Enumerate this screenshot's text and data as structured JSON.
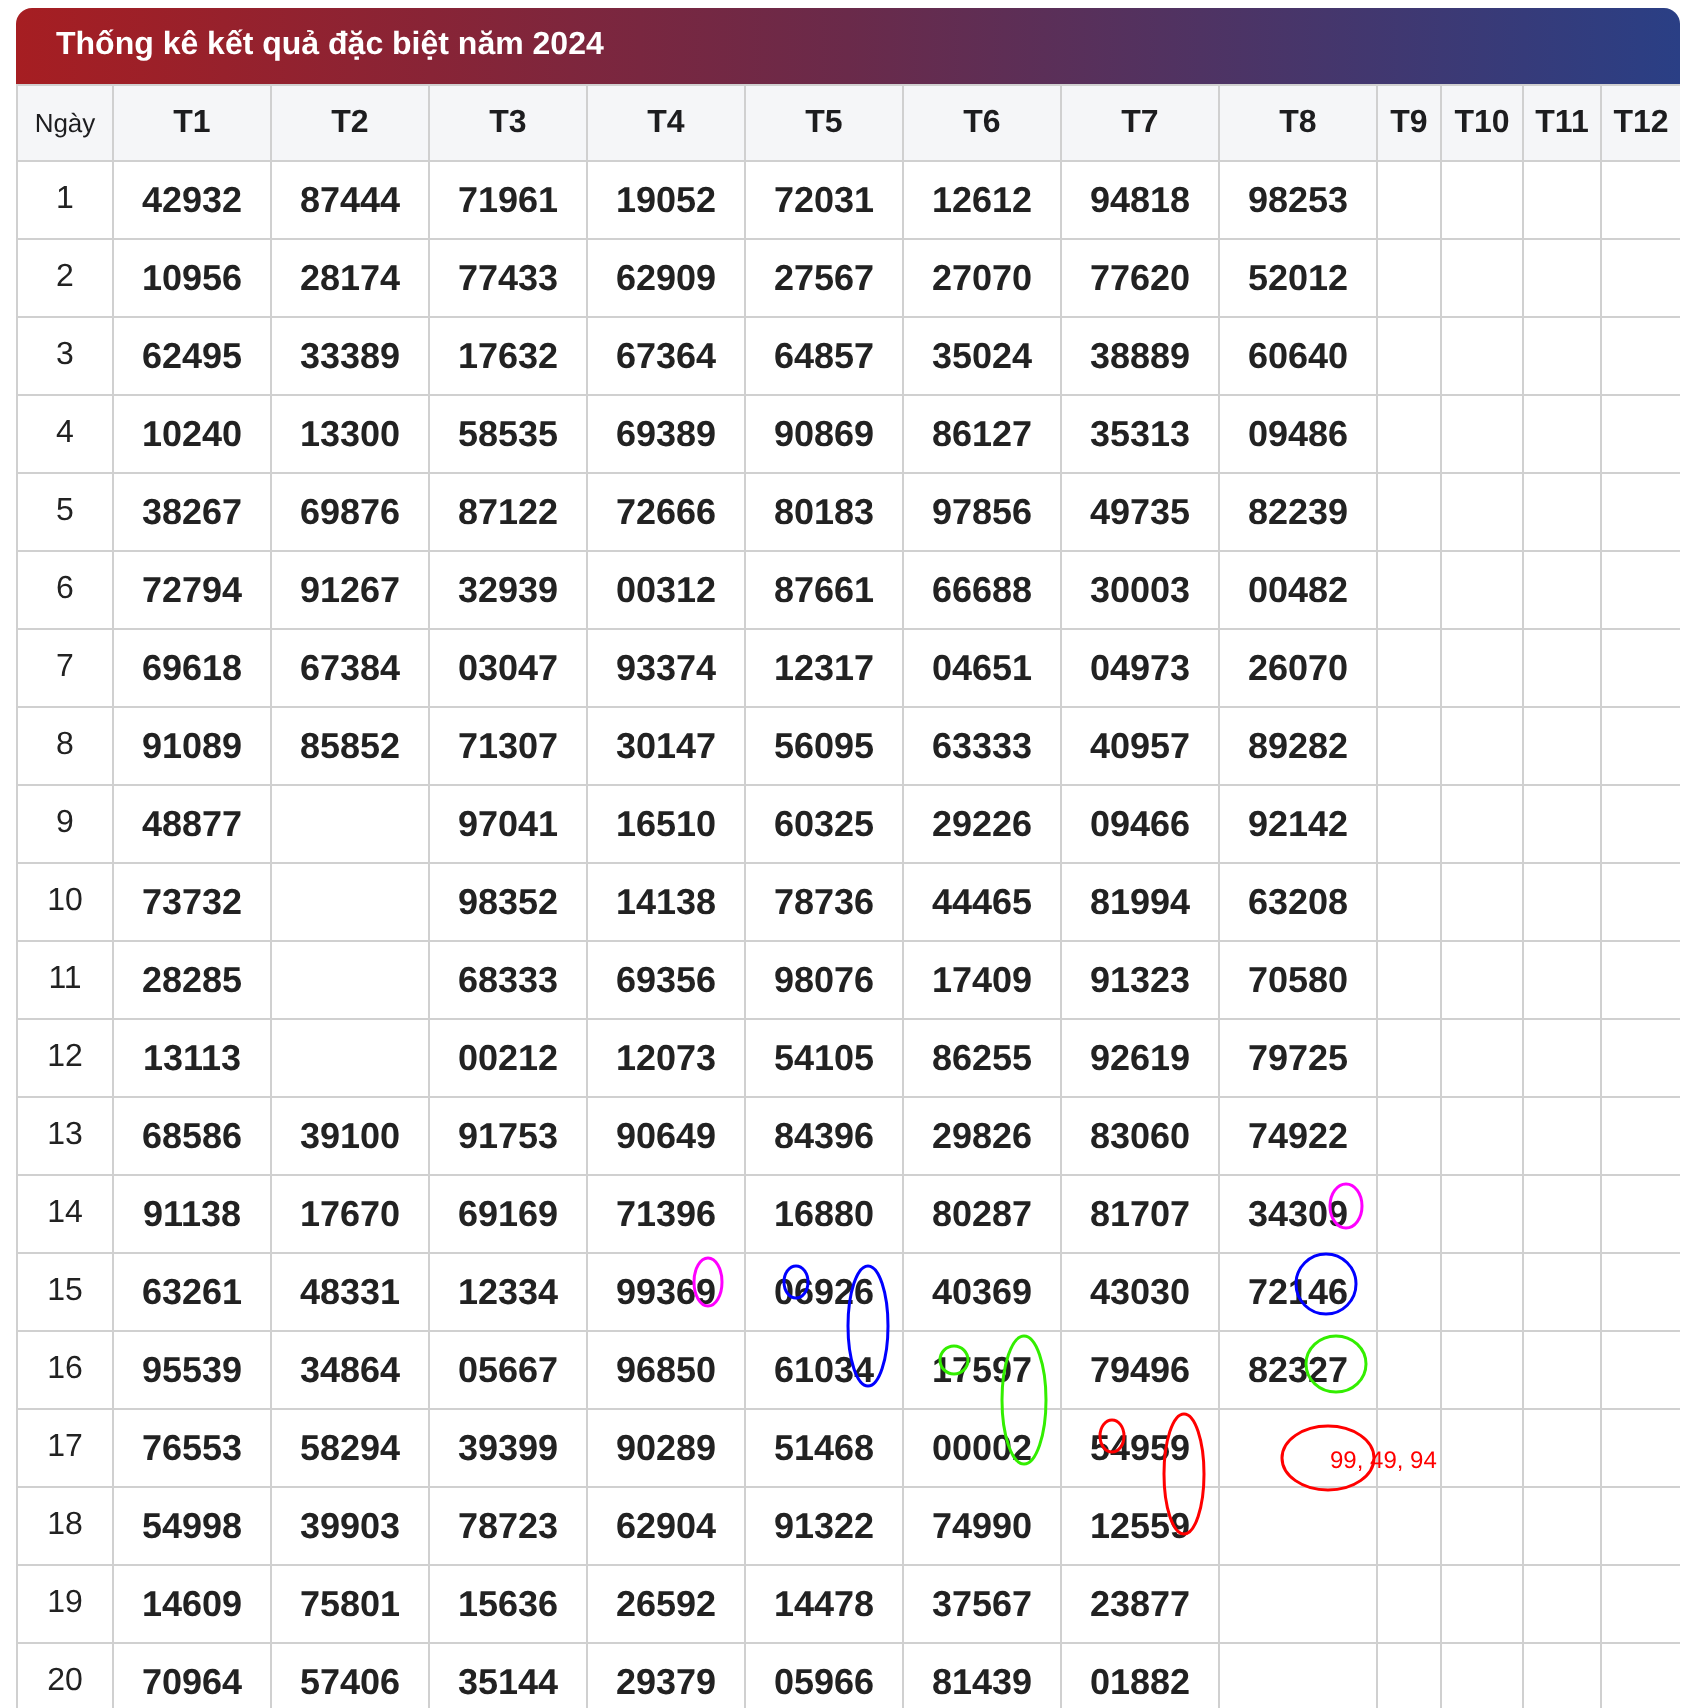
{
  "title": "Thống kê kết quả đặc biệt năm 2024",
  "columns": [
    "Ngày",
    "T1",
    "T2",
    "T3",
    "T4",
    "T5",
    "T6",
    "T7",
    "T8",
    "T9",
    "T10",
    "T11",
    "T12"
  ],
  "rows": [
    {
      "day": "1",
      "values": [
        "42932",
        "87444",
        "71961",
        "19052",
        "72031",
        "12612",
        "94818",
        "98253"
      ]
    },
    {
      "day": "2",
      "values": [
        "10956",
        "28174",
        "77433",
        "62909",
        "27567",
        "27070",
        "77620",
        "52012"
      ]
    },
    {
      "day": "3",
      "values": [
        "62495",
        "33389",
        "17632",
        "67364",
        "64857",
        "35024",
        "38889",
        "60640"
      ]
    },
    {
      "day": "4",
      "values": [
        "10240",
        "13300",
        "58535",
        "69389",
        "90869",
        "86127",
        "35313",
        "09486"
      ]
    },
    {
      "day": "5",
      "values": [
        "38267",
        "69876",
        "87122",
        "72666",
        "80183",
        "97856",
        "49735",
        "82239"
      ]
    },
    {
      "day": "6",
      "values": [
        "72794",
        "91267",
        "32939",
        "00312",
        "87661",
        "66688",
        "30003",
        "00482"
      ]
    },
    {
      "day": "7",
      "values": [
        "69618",
        "67384",
        "03047",
        "93374",
        "12317",
        "04651",
        "04973",
        "26070"
      ]
    },
    {
      "day": "8",
      "values": [
        "91089",
        "85852",
        "71307",
        "30147",
        "56095",
        "63333",
        "40957",
        "89282"
      ]
    },
    {
      "day": "9",
      "values": [
        "48877",
        {
          "empty": true
        },
        "97041",
        "16510",
        "60325",
        "29226",
        "09466",
        "92142"
      ]
    },
    {
      "day": "10",
      "values": [
        "73732",
        {
          "empty": true
        },
        "98352",
        "14138",
        "78736",
        "44465",
        "81994",
        "63208"
      ]
    },
    {
      "day": "11",
      "values": [
        "28285",
        {
          "empty": true
        },
        "68333",
        "69356",
        "98076",
        "17409",
        "91323",
        "70580"
      ]
    },
    {
      "day": "12",
      "values": [
        "13113",
        {
          "empty": true
        },
        "00212",
        "12073",
        "54105",
        "86255",
        "92619",
        "79725"
      ]
    },
    {
      "day": "13",
      "values": [
        "68586",
        "39100",
        "91753",
        "90649",
        "84396",
        "29826",
        "83060",
        "74922"
      ]
    },
    {
      "day": "14",
      "values": [
        "91138",
        "17670",
        "69169",
        "71396",
        "16880",
        "80287",
        "81707",
        "34309"
      ]
    },
    {
      "day": "15",
      "values": [
        "63261",
        "48331",
        "12334",
        "99369",
        "06926",
        "40369",
        "43030",
        "72146"
      ]
    },
    {
      "day": "16",
      "values": [
        "95539",
        "34864",
        "05667",
        "96850",
        "61034",
        "17597",
        "79496",
        "82327"
      ]
    },
    {
      "day": "17",
      "values": [
        "76553",
        "58294",
        "39399",
        "90289",
        "51468",
        "00002",
        "54959"
      ]
    },
    {
      "day": "18",
      "values": [
        "54998",
        "39903",
        "78723",
        "62904",
        "91322",
        "74990",
        "12559"
      ]
    },
    {
      "day": "19",
      "values": [
        "14609",
        "75801",
        "15636",
        "26592",
        "14478",
        "37567",
        "23877"
      ]
    },
    {
      "day": "20",
      "values": [
        "70964",
        "57406",
        "35144",
        "29379",
        "05966",
        "81439",
        "01882"
      ]
    }
  ],
  "annotations": [
    {
      "color": "#ff00ff"
    },
    {
      "color": "#ff00ff"
    },
    {
      "color": "#0000ff"
    },
    {
      "color": "#0000ff"
    },
    {
      "color": "#0000ff"
    },
    {
      "color": "#33ee00"
    },
    {
      "color": "#33ee00"
    },
    {
      "color": "#33ee00"
    },
    {
      "color": "#ff0000"
    },
    {
      "color": "#ff0000"
    },
    {
      "color": "#ff0000"
    }
  ],
  "note": {
    "text": "99, 49, 94",
    "color": "#ff0000"
  }
}
